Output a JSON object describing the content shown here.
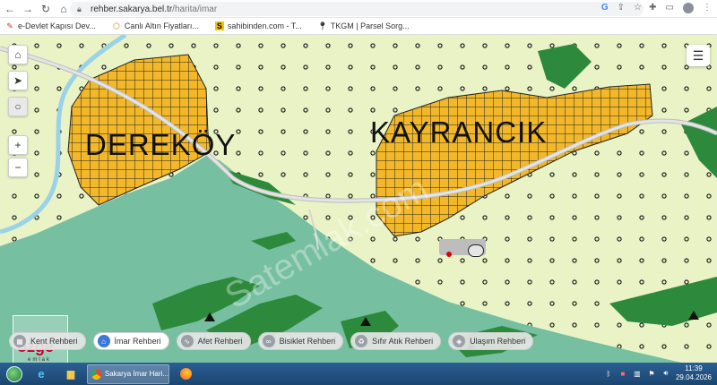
{
  "browser": {
    "url_host": "rehber.sakarya.bel.tr",
    "url_path": "/harita/imar"
  },
  "bookmarks": [
    {
      "label": "e-Devlet Kapısı Dev...",
      "icon": "edevlet-icon",
      "color": "#d32f2f"
    },
    {
      "label": "Canlı Altın Fiyatları...",
      "icon": "gold-icon",
      "color": "#b8860b"
    },
    {
      "label": "sahibinden.com - T...",
      "icon": "sahibinden-icon",
      "color": "#f5c400"
    },
    {
      "label": "TKGM | Parsel Sorg...",
      "icon": "map-pin-icon",
      "color": "#333333"
    }
  ],
  "map": {
    "place_labels": [
      "DEREKÖY",
      "KAYRANCIK"
    ],
    "watermark": "Satemlak.com",
    "zoom_in": "+",
    "zoom_out": "−",
    "colors": {
      "background": "#e9f3c6",
      "green_area": "#76bfa0",
      "forest": "#2d8a3c",
      "settlement": "#f2b82a",
      "road": "#cfcfcf",
      "river": "#9ad3e8"
    }
  },
  "rehber_buttons": [
    {
      "label": "Kent Rehberi",
      "icon": "building-icon",
      "active": false
    },
    {
      "label": "İmar Rehberi",
      "icon": "house-icon",
      "active": true
    },
    {
      "label": "Afet Rehberi",
      "icon": "pulse-icon",
      "active": false
    },
    {
      "label": "Bisiklet Rehberi",
      "icon": "bicycle-icon",
      "active": false
    },
    {
      "label": "Sıfır Atık Rehberi",
      "icon": "recycle-icon",
      "active": false
    },
    {
      "label": "Ulaşım Rehberi",
      "icon": "transport-icon",
      "active": false
    }
  ],
  "logo": {
    "text": "özge",
    "sub": "emlak"
  },
  "taskbar": {
    "task_label": "Sakarya İmar Hari...",
    "time": "11:39",
    "date": "29.04.2026"
  }
}
